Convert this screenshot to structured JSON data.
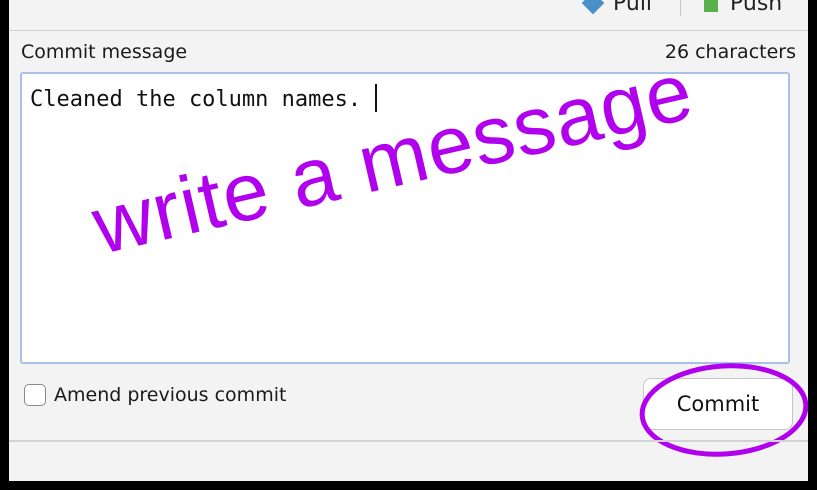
{
  "toolbar": {
    "pull_label": "Pull",
    "push_label": "Push",
    "pull_icon": "pull-diamond-icon",
    "push_icon": "push-square-icon"
  },
  "commit": {
    "message_label": "Commit message",
    "char_count": "26 characters",
    "message_value": "Cleaned the column names.",
    "amend_label": "Amend previous commit",
    "amend_checked": false,
    "commit_button_label": "Commit"
  },
  "annotation": {
    "text": "write a message",
    "color": "#b000ee"
  },
  "colors": {
    "panel_bg": "#f3f3f3",
    "textarea_border": "#a9c1e6",
    "annotation": "#b000ee"
  }
}
